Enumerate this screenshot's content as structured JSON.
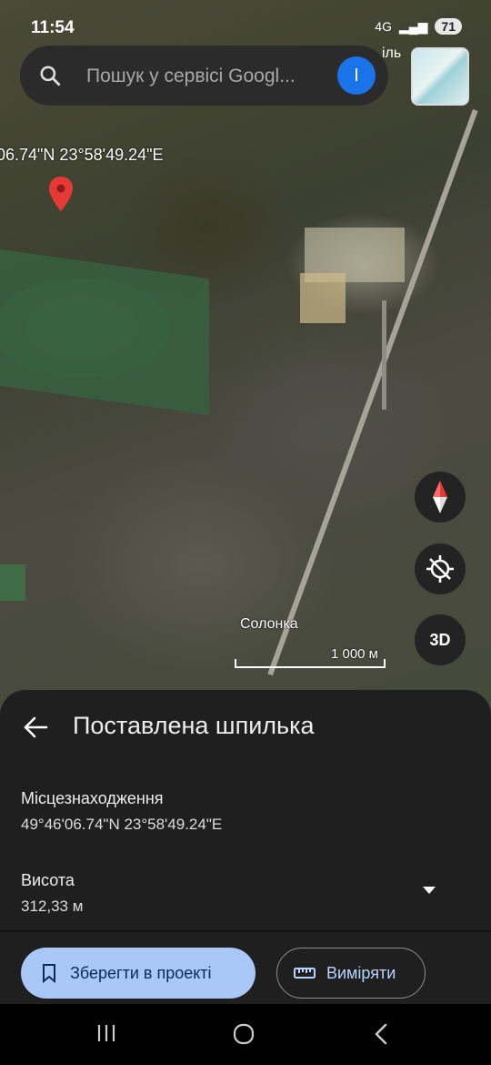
{
  "status_bar": {
    "time": "11:54",
    "network": "4G",
    "battery": "71"
  },
  "search": {
    "placeholder": "Пошук у сервісі Googl...",
    "avatar_letter": "I"
  },
  "map": {
    "top_place_fragment": "іль",
    "coordinate_label": "06.74\"N 23°58'49.24\"E",
    "place_label": "Солонка",
    "scale_label": "1 000 м",
    "threed_label": "3D"
  },
  "sheet": {
    "title": "Поставлена шпилька",
    "location_label": "Місцезнаходження",
    "location_value": "49°46'06.74\"N 23°58'49.24\"E",
    "elevation_label": "Висота",
    "elevation_value": "312,33 м",
    "save_label": "Зберегти в проекті",
    "measure_label": "Виміряти"
  }
}
